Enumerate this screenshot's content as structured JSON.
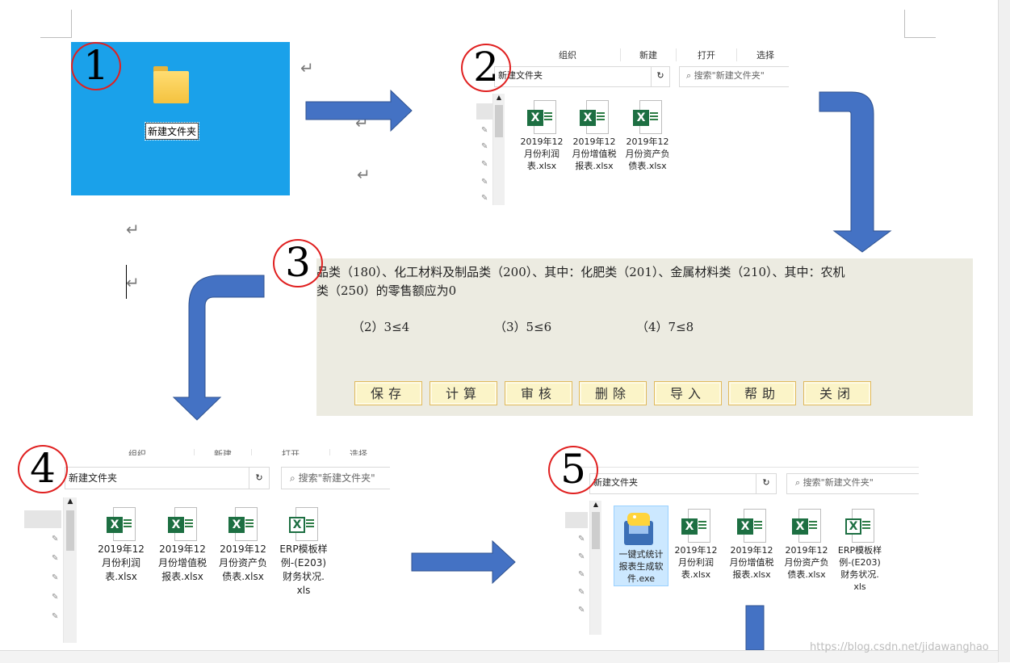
{
  "colors": {
    "arrow": "#4472c4",
    "circle": "#e02020",
    "desktop": "#1aa1ea",
    "dialog_bg": "#ecebe1",
    "excel_green": "#1d6f42"
  },
  "steps": [
    "1",
    "2",
    "3",
    "4",
    "5"
  ],
  "return_mark": "↵",
  "desktop": {
    "folder_label": "新建文件夹"
  },
  "explorer2": {
    "ribbon": [
      "组织",
      "新建",
      "打开",
      "选择"
    ],
    "address": "新建文件夹",
    "refresh": "↻",
    "search_placeholder": "搜索\"新建文件夹\"",
    "files": [
      {
        "icon": "excel-icon",
        "lines": [
          "2019年12",
          "月份利润",
          "表.xlsx"
        ]
      },
      {
        "icon": "excel-icon",
        "lines": [
          "2019年12",
          "月份增值税",
          "报表.xlsx"
        ]
      },
      {
        "icon": "excel-icon",
        "lines": [
          "2019年12",
          "月份资产负",
          "债表.xlsx"
        ]
      }
    ]
  },
  "dialog3": {
    "line1": "品类（180）、化工材料及制品类（200）、其中：化肥类（201）、金属材料类（210）、其中：农机",
    "line2": "类（250）的零售额应为0",
    "conditions": [
      "（2）3≤4",
      "（3）5≤6",
      "（4）7≤8"
    ],
    "buttons": [
      "保存",
      "计算",
      "审核",
      "删除",
      "导入",
      "帮助",
      "关闭"
    ]
  },
  "explorer4": {
    "ribbon": [
      "组织",
      "新建",
      "打开",
      "选择"
    ],
    "address": "新建文件夹",
    "refresh": "↻",
    "search_placeholder": "搜索\"新建文件夹\"",
    "files": [
      {
        "icon": "excel-icon",
        "lines": [
          "2019年12",
          "月份利润",
          "表.xlsx"
        ]
      },
      {
        "icon": "excel-icon",
        "lines": [
          "2019年12",
          "月份增值税",
          "报表.xlsx"
        ]
      },
      {
        "icon": "excel-icon",
        "lines": [
          "2019年12",
          "月份资产负",
          "债表.xlsx"
        ]
      },
      {
        "icon": "excel-legacy-icon",
        "lines": [
          "ERP模板样",
          "例-(E203)",
          "财务状况.",
          "xls"
        ]
      }
    ]
  },
  "explorer5": {
    "address": "新建文件夹",
    "refresh": "↻",
    "search_placeholder": "搜索\"新建文件夹\"",
    "files": [
      {
        "icon": "python-exe-icon",
        "lines": [
          "一键式统计",
          "报表生成软",
          "件.exe"
        ],
        "selected": true
      },
      {
        "icon": "excel-icon",
        "lines": [
          "2019年12",
          "月份利润",
          "表.xlsx"
        ]
      },
      {
        "icon": "excel-icon",
        "lines": [
          "2019年12",
          "月份增值税",
          "报表.xlsx"
        ]
      },
      {
        "icon": "excel-icon",
        "lines": [
          "2019年12",
          "月份资产负",
          "债表.xlsx"
        ]
      },
      {
        "icon": "excel-legacy-icon",
        "lines": [
          "ERP模板样",
          "例-(E203)",
          "财务状况.",
          "xls"
        ]
      }
    ]
  },
  "watermark": "https://blog.csdn.net/jidawanghao"
}
